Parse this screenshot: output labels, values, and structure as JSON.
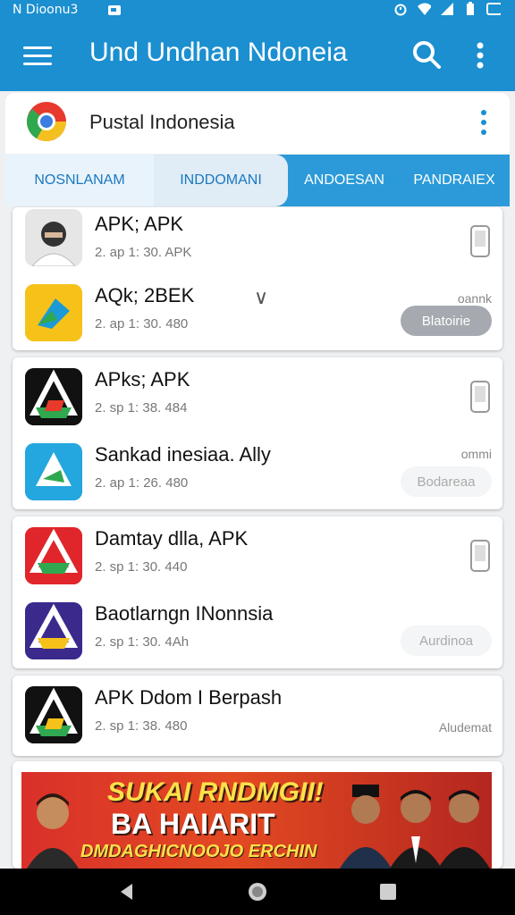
{
  "status_bar": {
    "carrier": "N Dioonu3",
    "icons": [
      "notification-icon",
      "alarm-icon",
      "wifi-icon",
      "signal-icon",
      "battery-icon",
      "screenshot-icon"
    ]
  },
  "app_bar": {
    "title": "Und Undhan Ndoneia"
  },
  "sub_header": {
    "title": "Pustal Indonesia"
  },
  "tabs": [
    "NOSNLANAM",
    "INDDOMANI",
    "ANDOESAN",
    "PANDRAIEX"
  ],
  "cards": [
    {
      "rows": [
        {
          "name": "APK; APK",
          "meta": "2. ap 1: 30. APK",
          "side": "phone",
          "label": "",
          "pill": ""
        },
        {
          "name": "AQk; 2BEK",
          "meta": "2. ap 1: 30. 480",
          "side": "pill",
          "label": "oannk",
          "pill": "Blatoirie"
        }
      ]
    },
    {
      "rows": [
        {
          "name": "APks; APK",
          "meta": "2. sp 1: 38. 484",
          "side": "phone",
          "label": "",
          "pill": ""
        },
        {
          "name": "Sankad inesiaa. Ally",
          "meta": "2. ap 1: 26. 480",
          "side": "pill",
          "label": "ommi",
          "pill": "Bodareaa"
        }
      ]
    },
    {
      "rows": [
        {
          "name": "Damtay dlla, APK",
          "meta": "2. sp 1: 30. 440",
          "side": "phone",
          "label": "",
          "pill": ""
        },
        {
          "name": "Baotlarngn INonnsia",
          "meta": "2. sp 1: 30. 4Ah",
          "side": "pill",
          "label": "",
          "pill": "Aurdinoa"
        }
      ]
    },
    {
      "rows": [
        {
          "name": "APK Ddom I Berpash",
          "meta": "2. sp 1: 38. 480",
          "side": "label",
          "label": "Aludemat",
          "pill": ""
        }
      ]
    }
  ],
  "banner": {
    "line1": "SUKAI RNDMGII!",
    "line2": "BA HAIARIT",
    "line3": "DMDAGHICNOOJO ERCHIN"
  },
  "nav": [
    "back-icon",
    "home-icon",
    "recents-icon"
  ]
}
